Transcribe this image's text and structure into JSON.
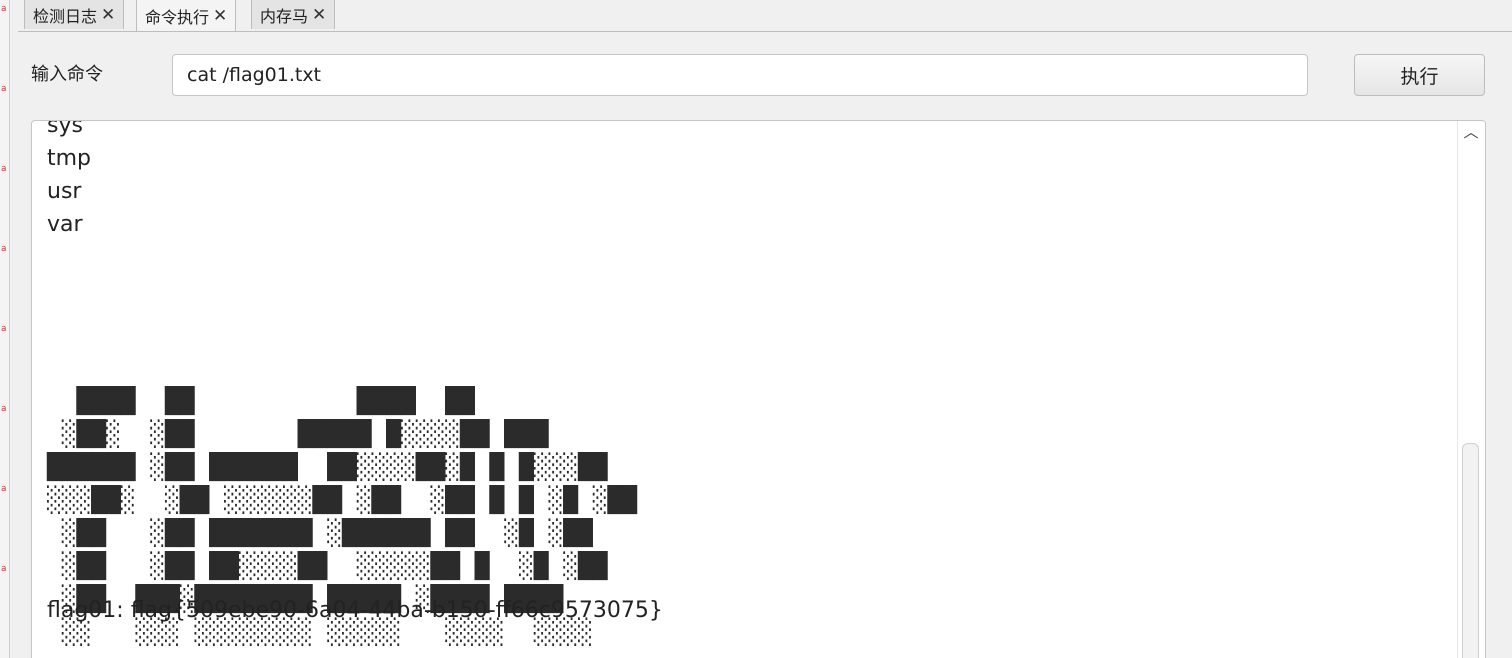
{
  "tabs": [
    {
      "label": "检测日志",
      "close": "✕"
    },
    {
      "label": "命令执行",
      "close": "✕"
    },
    {
      "label": "内存马",
      "close": "✕"
    }
  ],
  "command": {
    "label": "输入命令",
    "value": "cat /flag01.txt",
    "execute_label": "执行"
  },
  "output": {
    "lines": "sys\ntmp\nusr\nvar",
    "ascii_art": "  ████  ██           ████  ██\n ░██░  ░██       █████ █░░░░██ ███\n██████ ░██ ██████  ██░░░░██░█ █ █░░░██\n░░░██░  ░██ ░░░░░░██ ░██  ░██ █ █ ░█ ░██\n ░██   ░██ ███████ ░██████ ██  ░█ ░██\n ░██   ░██ ██░░░░██  ░░░░░██ █  ░█ ░██\n ░██  ███░████████ █████ ░████ ████\n ░░   ░░░ ░░░░░░░░ ░░░░░   ░░░░  ░░░░",
    "flag_line": "flag01: flag{509ebe90-6a04-44ba-b150-ff66c9573075}"
  },
  "gutter_marks": [
    "a",
    "a",
    "a",
    "a",
    "a",
    "a",
    "a",
    "a"
  ]
}
